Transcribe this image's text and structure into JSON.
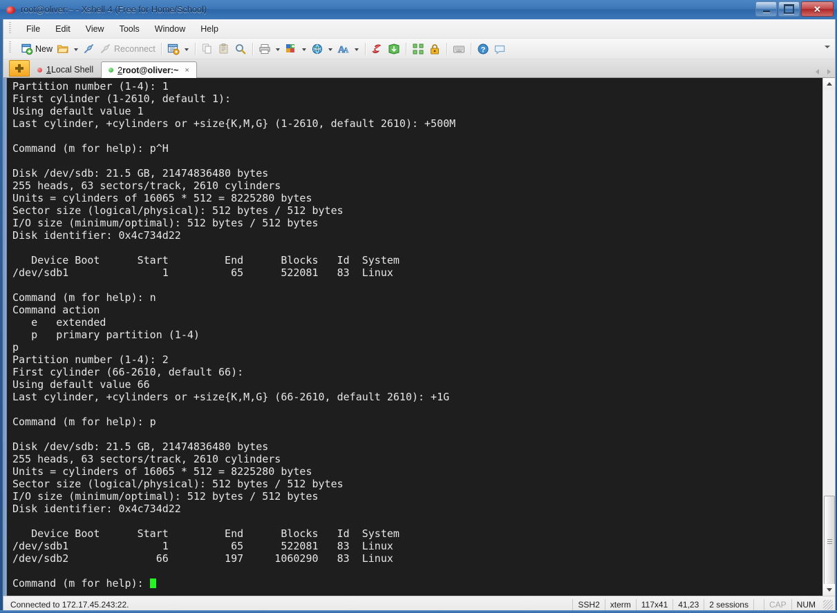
{
  "window": {
    "title": "root@oliver:~ - Xshell 4 (Free for Home/School)",
    "app_icon": "xshell-icon",
    "minimize_label": "",
    "maximize_label": "",
    "close_label": "✕"
  },
  "menu": {
    "items": [
      {
        "label": "File",
        "name": "menu-file"
      },
      {
        "label": "Edit",
        "name": "menu-edit"
      },
      {
        "label": "View",
        "name": "menu-view"
      },
      {
        "label": "Tools",
        "name": "menu-tools"
      },
      {
        "label": "Window",
        "name": "menu-window"
      },
      {
        "label": "Help",
        "name": "menu-help"
      }
    ]
  },
  "toolbar": {
    "new_label": "New",
    "reconnect_label": "Reconnect",
    "icons": [
      "new-session-icon",
      "open-folder-icon",
      "connect-icon",
      "reconnect-icon",
      "properties-icon",
      "copy-icon",
      "paste-icon",
      "find-icon",
      "print-icon",
      "color-scheme-icon",
      "globe-icon",
      "font-icon",
      "session-manager-icon",
      "transfer-icon",
      "fullscreen-icon",
      "lock-icon",
      "keyboard-icon",
      "help-icon",
      "feedback-icon"
    ]
  },
  "tabs": {
    "new_tab_label": "+",
    "items": [
      {
        "num": "1",
        "label": " Local Shell",
        "status": "disconnected",
        "active": false,
        "name": "tab-local-shell"
      },
      {
        "num": "2",
        "label": " root@oliver:~",
        "status": "connected",
        "active": true,
        "name": "tab-root-oliver",
        "close": "×"
      }
    ],
    "nav_prev": "prev-tab-arrow",
    "nav_next": "next-tab-arrow"
  },
  "terminal": {
    "cursor_color": "#24f324",
    "background": "#1e1e1e",
    "foreground": "#e6e6e6",
    "lines": [
      "Partition number (1-4): 1",
      "First cylinder (1-2610, default 1):",
      "Using default value 1",
      "Last cylinder, +cylinders or +size{K,M,G} (1-2610, default 2610): +500M",
      "",
      "Command (m for help): p^H",
      "",
      "Disk /dev/sdb: 21.5 GB, 21474836480 bytes",
      "255 heads, 63 sectors/track, 2610 cylinders",
      "Units = cylinders of 16065 * 512 = 8225280 bytes",
      "Sector size (logical/physical): 512 bytes / 512 bytes",
      "I/O size (minimum/optimal): 512 bytes / 512 bytes",
      "Disk identifier: 0x4c734d22",
      "",
      "   Device Boot      Start         End      Blocks   Id  System",
      "/dev/sdb1               1          65      522081   83  Linux",
      "",
      "Command (m for help): n",
      "Command action",
      "   e   extended",
      "   p   primary partition (1-4)",
      "p",
      "Partition number (1-4): 2",
      "First cylinder (66-2610, default 66):",
      "Using default value 66",
      "Last cylinder, +cylinders or +size{K,M,G} (66-2610, default 2610): +1G",
      "",
      "Command (m for help): p",
      "",
      "Disk /dev/sdb: 21.5 GB, 21474836480 bytes",
      "255 heads, 63 sectors/track, 2610 cylinders",
      "Units = cylinders of 16065 * 512 = 8225280 bytes",
      "Sector size (logical/physical): 512 bytes / 512 bytes",
      "I/O size (minimum/optimal): 512 bytes / 512 bytes",
      "Disk identifier: 0x4c734d22",
      "",
      "   Device Boot      Start         End      Blocks   Id  System",
      "/dev/sdb1               1          65      522081   83  Linux",
      "/dev/sdb2              66         197     1060290   83  Linux",
      ""
    ],
    "prompt_line": "Command (m for help): "
  },
  "statusbar": {
    "connection": "Connected to 172.17.45.243:22.",
    "protocol": "SSH2",
    "term_type": "xterm",
    "size": "117x41",
    "position": "41,23",
    "sessions": "2 sessions",
    "caps": "CAP",
    "num": "NUM"
  }
}
